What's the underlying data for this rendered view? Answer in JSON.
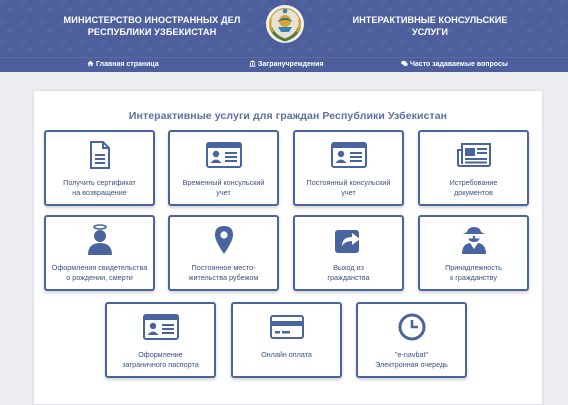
{
  "header": {
    "left_title": "МИНИСТЕРСТВО ИНОСТРАННЫХ ДЕЛ\nРЕСПУБЛИКИ УЗБЕКИСТАН",
    "left_line1": "МИНИСТЕРСТВО ИНОСТРАННЫХ ДЕЛ",
    "left_line2": "РЕСПУБЛИКИ УЗБЕКИСТАН",
    "right_line1": "ИНТЕРАКТИВНЫЕ КОНСУЛЬСКИЕ",
    "right_line2": "УСЛУГИ"
  },
  "nav": {
    "home": "Главная страница",
    "embassies": "Загранучреждения",
    "faq": "Часто задаваемые вопросы"
  },
  "main": {
    "title": "Интерактивные услуги для граждан Республики Узбекистан"
  },
  "services": [
    {
      "label": "Получить сертификат\nна возвращение",
      "icon": "document-icon"
    },
    {
      "label": "Временный консульский\nучет",
      "icon": "id-card-icon"
    },
    {
      "label": "Постоянный консульский\nучет",
      "icon": "id-card-icon"
    },
    {
      "label": "Истребование\nдокументов",
      "icon": "newspaper-icon"
    },
    {
      "label": "Оформления свидетельства\nо рождении, смерти",
      "icon": "angel-icon"
    },
    {
      "label": "Постоянное место-\nжительства рубежом",
      "icon": "map-marker-icon"
    },
    {
      "label": "Выход из\nгражданства",
      "icon": "share-icon"
    },
    {
      "label": "Принадлежность\nк гражданству",
      "icon": "user-secret-icon"
    },
    {
      "label": "Оформление\nзаграничного паспорта",
      "icon": "id-card-icon"
    },
    {
      "label": "Онлайн оплата",
      "icon": "credit-card-icon"
    },
    {
      "label": "\"e-navbat\"\nЭлектронная очередь",
      "icon": "clock-icon"
    }
  ],
  "colors": {
    "header_bg": "#4c5f9c",
    "card_border": "#4a64a0",
    "icon": "#4a64a0",
    "card_text": "#3b4f86",
    "title": "#5d6f9e"
  }
}
